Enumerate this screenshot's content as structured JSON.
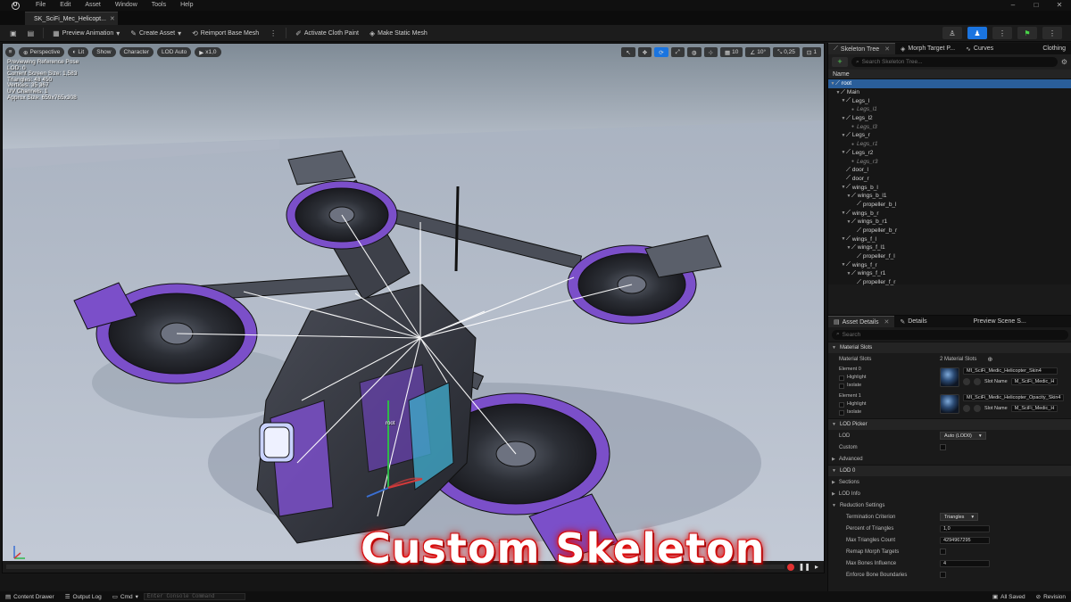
{
  "menu": {
    "items": [
      "File",
      "Edit",
      "Asset",
      "Window",
      "Tools",
      "Help"
    ]
  },
  "document_tab": {
    "label": "SK_SciFi_Mec_Helicopt..."
  },
  "toolbar": {
    "preview_animation": "Preview Animation",
    "create_asset": "Create Asset",
    "reimport_base_mesh": "Reimport Base Mesh",
    "activate_cloth_paint": "Activate Cloth Paint",
    "make_static_mesh": "Make Static Mesh"
  },
  "viewport": {
    "chips": {
      "perspective": "Perspective",
      "lit": "Lit",
      "show": "Show",
      "character": "Character",
      "lod": "LOD Auto",
      "play_rate": "x1,0"
    },
    "right_values": {
      "grid_snap": "10",
      "rot_snap": "10°",
      "scale_snap": "0,25",
      "cam_speed": "1"
    },
    "stats": [
      "Previewing Reference Pose",
      "LOD: 0",
      "Current Screen Size: 1,583",
      "Triangles: 48 450",
      "Vertices: 35 367",
      "UV Channels: 1",
      "Approx Size: 659x765x308"
    ],
    "root_label": "root",
    "overlay_title": "Custom Skeleton"
  },
  "skeleton_panel": {
    "tabs": [
      {
        "label": "Skeleton Tree",
        "closable": true
      },
      {
        "label": "Morph Target P...",
        "closable": false
      },
      {
        "label": "Curves",
        "closable": false
      },
      {
        "label": "Clothing",
        "closable": false
      }
    ],
    "search_placeholder": "Search Skeleton Tree...",
    "column_name": "Name",
    "tree": [
      {
        "label": "root",
        "depth": 0,
        "kind": "bone",
        "expanded": true,
        "selected": true
      },
      {
        "label": "Main",
        "depth": 1,
        "kind": "bone",
        "expanded": true
      },
      {
        "label": "Legs_l",
        "depth": 2,
        "kind": "bone",
        "expanded": true
      },
      {
        "label": "Legs_l1",
        "depth": 3,
        "kind": "socket"
      },
      {
        "label": "Legs_l2",
        "depth": 2,
        "kind": "bone",
        "expanded": true
      },
      {
        "label": "Legs_l3",
        "depth": 3,
        "kind": "socket"
      },
      {
        "label": "Legs_r",
        "depth": 2,
        "kind": "bone",
        "expanded": true
      },
      {
        "label": "Legs_r1",
        "depth": 3,
        "kind": "socket"
      },
      {
        "label": "Legs_r2",
        "depth": 2,
        "kind": "bone",
        "expanded": true
      },
      {
        "label": "Legs_r3",
        "depth": 3,
        "kind": "socket"
      },
      {
        "label": "door_l",
        "depth": 2,
        "kind": "bone"
      },
      {
        "label": "door_r",
        "depth": 2,
        "kind": "bone"
      },
      {
        "label": "wings_b_l",
        "depth": 2,
        "kind": "bone",
        "expanded": true
      },
      {
        "label": "wings_b_l1",
        "depth": 3,
        "kind": "bone",
        "expanded": true
      },
      {
        "label": "propeller_b_l",
        "depth": 4,
        "kind": "bone"
      },
      {
        "label": "wings_b_r",
        "depth": 2,
        "kind": "bone",
        "expanded": true
      },
      {
        "label": "wings_b_r1",
        "depth": 3,
        "kind": "bone",
        "expanded": true
      },
      {
        "label": "propeller_b_r",
        "depth": 4,
        "kind": "bone"
      },
      {
        "label": "wings_f_l",
        "depth": 2,
        "kind": "bone",
        "expanded": true
      },
      {
        "label": "wings_f_l1",
        "depth": 3,
        "kind": "bone",
        "expanded": true
      },
      {
        "label": "propeller_f_l",
        "depth": 4,
        "kind": "bone"
      },
      {
        "label": "wings_f_r",
        "depth": 2,
        "kind": "bone",
        "expanded": true
      },
      {
        "label": "wings_f_r1",
        "depth": 3,
        "kind": "bone",
        "expanded": true
      },
      {
        "label": "propeller_f_r",
        "depth": 4,
        "kind": "bone"
      }
    ]
  },
  "details_panel": {
    "tabs": [
      {
        "label": "Asset Details",
        "closable": true
      },
      {
        "label": "Details",
        "closable": false
      },
      {
        "label": "Preview Scene S...",
        "closable": false
      }
    ],
    "search_placeholder": "Search",
    "material_slots": {
      "section": "Material Slots",
      "row_label": "Material Slots",
      "count": "2 Material Slots",
      "elements": [
        {
          "label": "Element 0",
          "highlight": "Highlight",
          "isolate": "Isolate",
          "material": "MI_SciFi_Medic_Helicopter_Skin4",
          "slot_label": "Slot Name",
          "slot_value": "M_SciFi_Medic_H"
        },
        {
          "label": "Element 1",
          "highlight": "Highlight",
          "isolate": "Isolate",
          "material": "MI_SciFi_Medic_Helicopter_Opacity_Skin4",
          "slot_label": "Slot Name",
          "slot_value": "M_SciFi_Medic_H"
        }
      ]
    },
    "lod_picker": {
      "section": "LOD Picker",
      "lod_label": "LOD",
      "lod_value": "Auto (LOD0)",
      "custom_label": "Custom"
    },
    "advanced": "Advanced",
    "lod0": {
      "section": "LOD 0",
      "sections": "Sections",
      "lod_info": "LOD Info",
      "reduction": "Reduction Settings",
      "rows": [
        {
          "label": "Termination Criterion",
          "type": "dropdown",
          "value": "Triangles"
        },
        {
          "label": "Percent of Triangles",
          "type": "field",
          "value": "1,0"
        },
        {
          "label": "Max Triangles Count",
          "type": "field",
          "value": "4294967295"
        },
        {
          "label": "Remap Morph Targets",
          "type": "checkbox"
        },
        {
          "label": "Max Bones Influence",
          "type": "field",
          "value": "4"
        },
        {
          "label": "Enforce Bone Boundaries",
          "type": "checkbox"
        }
      ]
    }
  },
  "statusbar": {
    "content_drawer": "Content Drawer",
    "output_log": "Output Log",
    "cmd": "Cmd",
    "console_placeholder": "Enter Console Command",
    "all_saved": "All Saved",
    "revision": "Revision"
  },
  "icons": {
    "ue_logo": "unreal-logo-icon",
    "bone": "bone-icon",
    "socket": "socket-icon",
    "search": "search-icon",
    "add": "add-icon",
    "settings": "gear-icon"
  },
  "colors": {
    "accent": "#1a74e0",
    "mesh_purple": "#7b4fc9",
    "title_glow": "#d40000",
    "selection": "#2a5e9a"
  }
}
